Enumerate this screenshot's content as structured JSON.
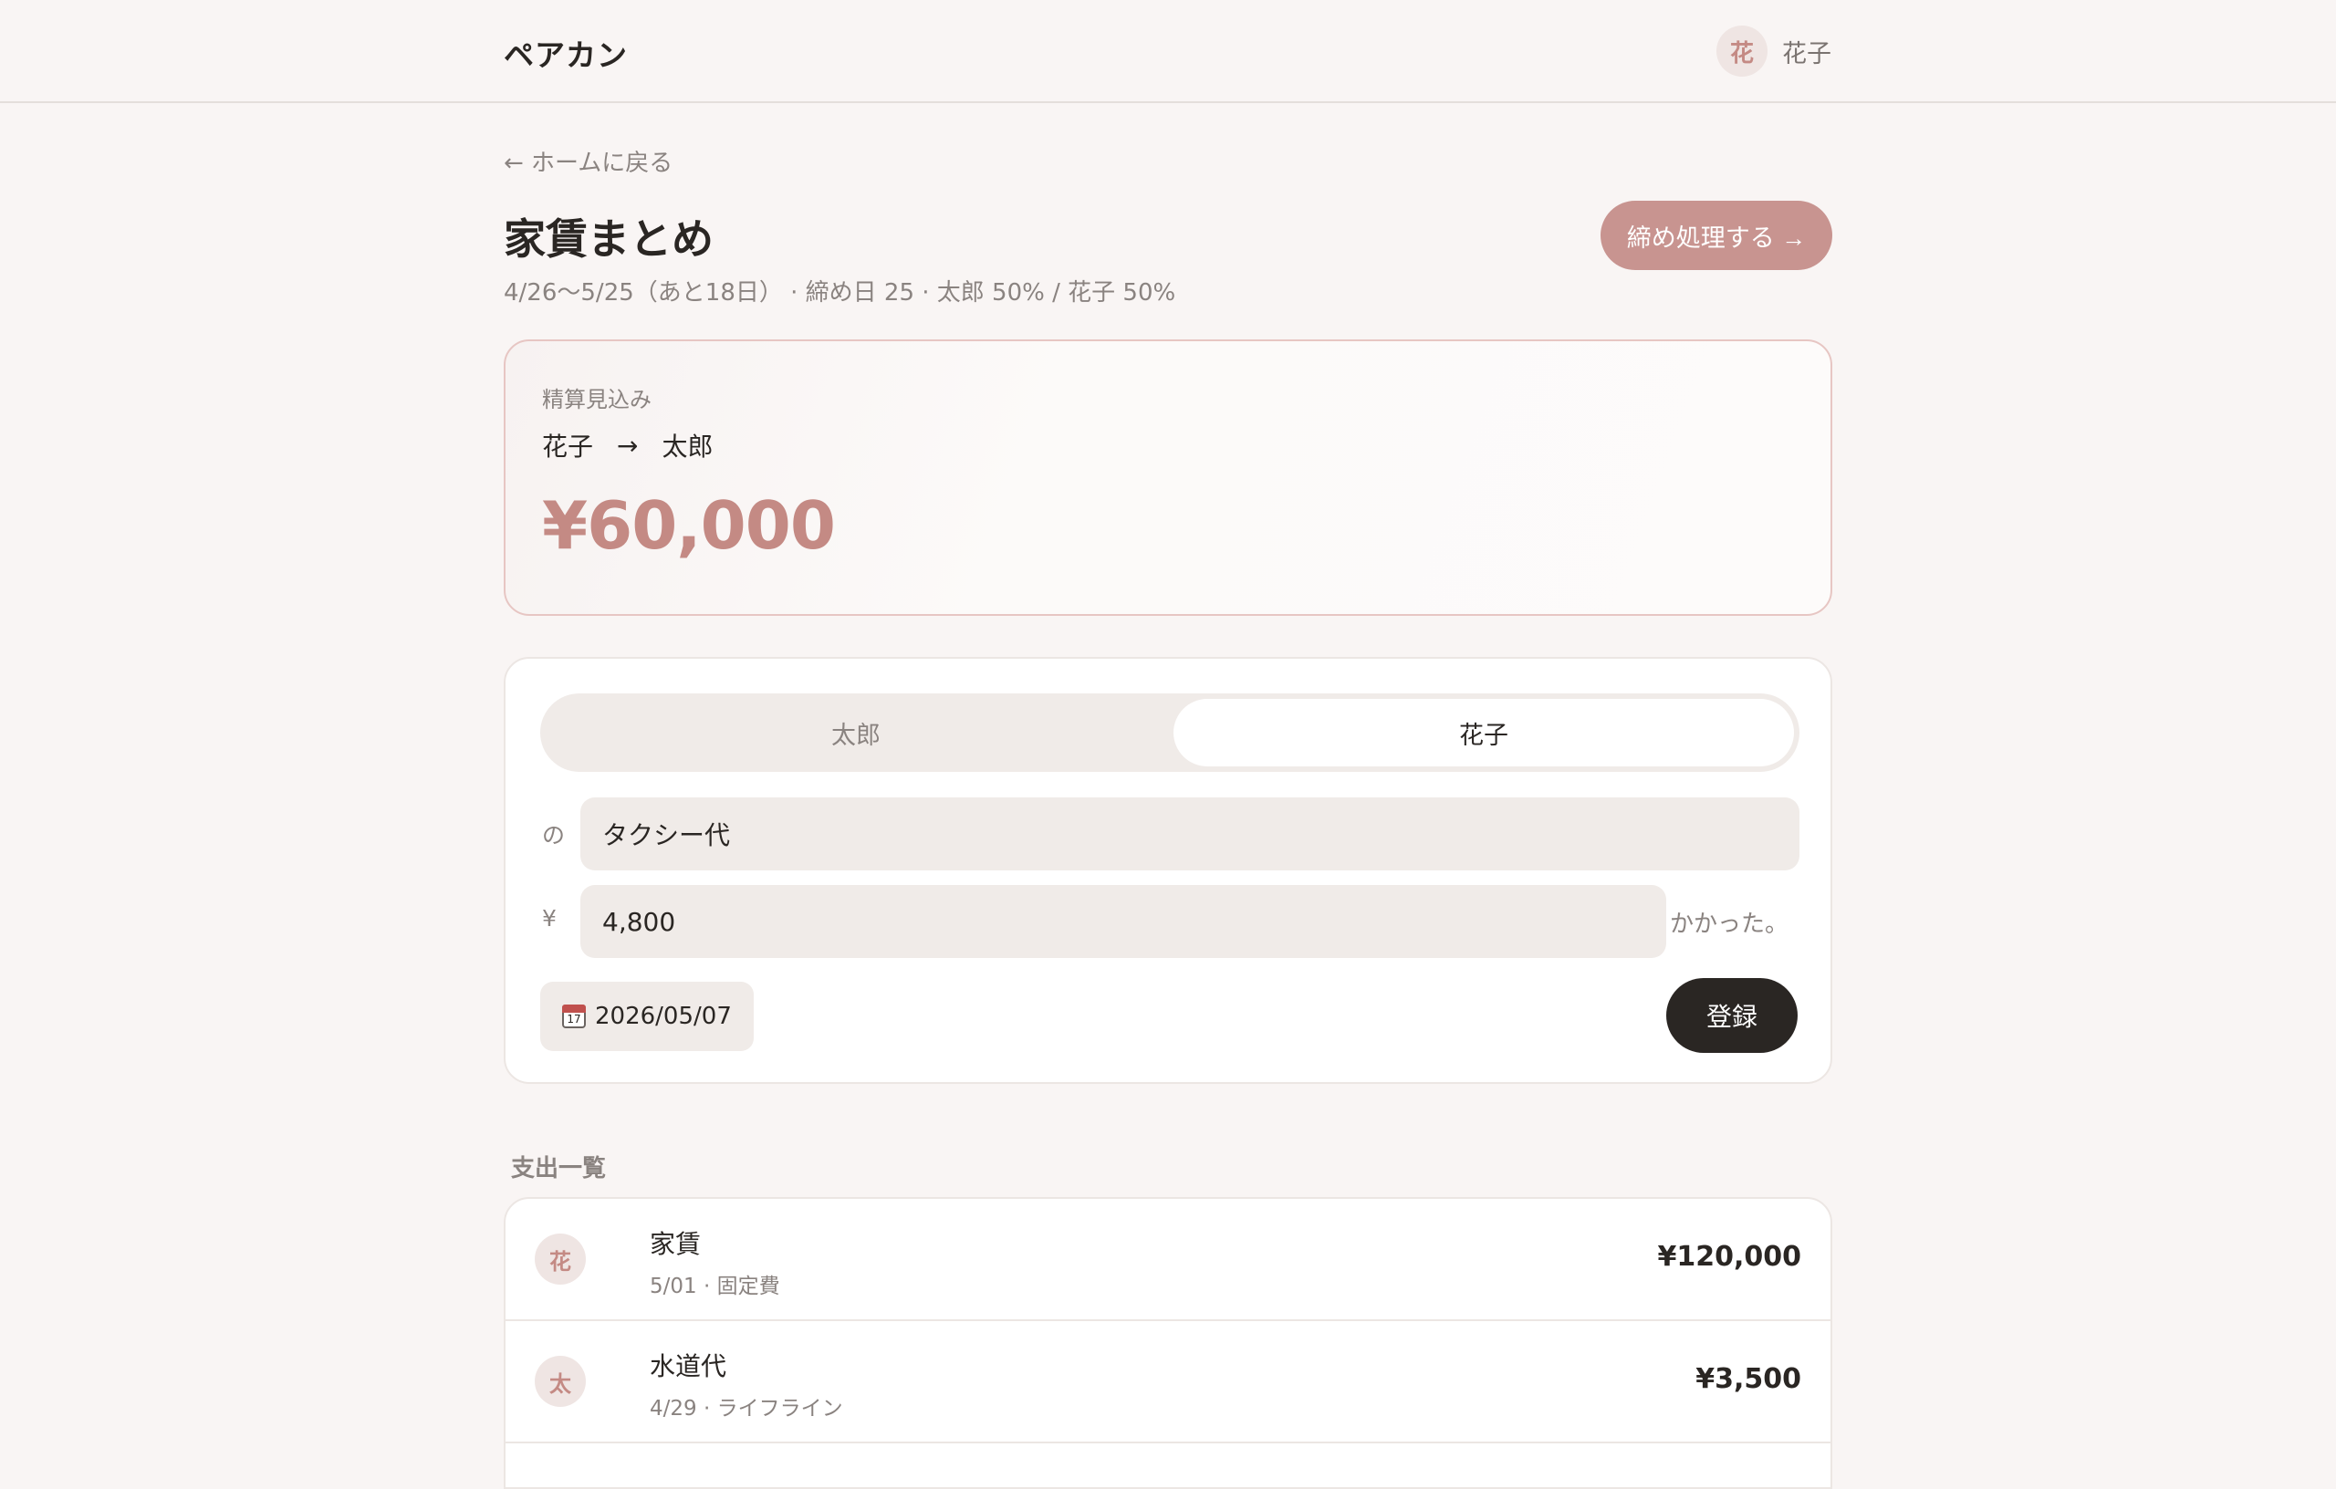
{
  "header": {
    "brand": "ペアカン",
    "user_avatar": "花",
    "user_name": "花子"
  },
  "nav": {
    "back_label": "← ホームに戻る"
  },
  "page": {
    "title": "家賃まとめ",
    "subtitle": "4/26〜5/25（あと18日） · 締め日 25 · 太郎 50% / 花子 50%",
    "close_button": "締め処理する →"
  },
  "settlement": {
    "label": "精算見込み",
    "from": "花子",
    "arrow": "→",
    "to": "太郎",
    "amount": "¥60,000"
  },
  "form": {
    "payer_options": [
      "太郎",
      "花子"
    ],
    "selected_payer": "花子",
    "item_prefix": "の",
    "item_value": "タクシー代",
    "amount_prefix": "¥",
    "amount_value": "4,800",
    "amount_suffix": "かかった。",
    "date": "2026/05/07",
    "submit_label": "登録"
  },
  "expenses": {
    "title": "支出一覧",
    "items": [
      {
        "avatar": "花",
        "title": "家賃",
        "meta": "5/01 · 固定費",
        "amount": "¥120,000"
      },
      {
        "avatar": "太",
        "title": "水道代",
        "meta": "4/29 · ライフライン",
        "amount": "¥3,500"
      }
    ]
  },
  "colors": {
    "accent": "#c48a84",
    "button_accent": "#c89490",
    "dark": "#2a2623"
  },
  "icons": {
    "date": "calendar-icon"
  }
}
